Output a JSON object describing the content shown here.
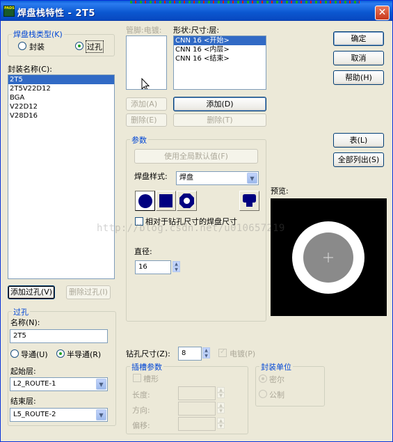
{
  "window": {
    "title": "焊盘栈特性 - 2T5",
    "app_icon_text": "PADS",
    "close_glyph": "✕"
  },
  "pad_stack_type": {
    "legend": "焊盘栈类型(K)",
    "options": [
      {
        "label": "封装",
        "selected": false
      },
      {
        "label": "过孔",
        "selected": true
      }
    ]
  },
  "package_list": {
    "label": "封装名称(C):",
    "items": [
      "2T5",
      "2T5V22D12",
      "BGA",
      "V22D12",
      "V28D16"
    ],
    "selected_index": 0
  },
  "via_buttons": {
    "add": "添加过孔(V)",
    "delete": "删除过孔(I)"
  },
  "via": {
    "legend": "过孔",
    "name_label": "名称(N):",
    "name_value": "2T5",
    "type_options": [
      {
        "label": "导通(U)",
        "selected": false
      },
      {
        "label": "半导通(R)",
        "selected": true
      }
    ],
    "start_layer_label": "起始层:",
    "start_layer_value": "L2_ROUTE-1",
    "end_layer_label": "结束层:",
    "end_layer_value": "L5_ROUTE-2"
  },
  "pin_plating": {
    "label": "管脚:电镀:",
    "add": "添加(A)",
    "delete": "删除(E)"
  },
  "shape_list": {
    "label": "形状:尺寸:层:",
    "items": [
      "CNN 16 <开始>",
      "CNN 16 <内层>",
      "CNN 16 <结束>"
    ],
    "selected_index": 0,
    "add": "添加(D)",
    "delete": "删除(T)"
  },
  "params": {
    "legend": "参数",
    "global_default": "使用全局默认值(F)",
    "pad_style_label": "焊盘样式:",
    "pad_style_value": "焊盘",
    "relative_label": "相对于钻孔尺寸的焊盘尺寸",
    "diameter_label": "直径:",
    "diameter_value": "16",
    "shape_icons": [
      "round-pad-icon",
      "square-pad-icon",
      "annular-pad-icon",
      "custom-pad-icon"
    ]
  },
  "drill": {
    "label": "钻孔尺寸(Z):",
    "value": "8",
    "plated_label": "电镀(P)",
    "plated": true
  },
  "slot": {
    "legend": "插槽参数",
    "slotted_label": "槽形",
    "length_label": "长度:",
    "direction_label": "方向:",
    "offset_label": "偏移:"
  },
  "units": {
    "legend": "封装单位",
    "options": [
      {
        "label": "密尔",
        "selected": true
      },
      {
        "label": "公制",
        "selected": false
      }
    ]
  },
  "actions": {
    "ok": "确定",
    "cancel": "取消",
    "help": "帮助(H)",
    "table": "表(L)",
    "list_all": "全部列出(S)"
  },
  "preview": {
    "label": "预览:",
    "outer_color": "#ffffff",
    "inner_color": "#8a8a8a",
    "bg_color": "#000000"
  },
  "watermark": "http://blog.csdn.net/u010657219"
}
